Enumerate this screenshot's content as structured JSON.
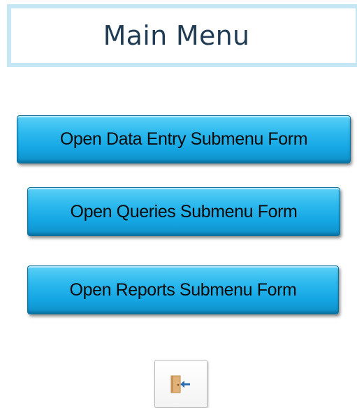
{
  "header": {
    "title": "Main Menu"
  },
  "menu": {
    "buttons": [
      {
        "label": "Open Data Entry Submenu Form"
      },
      {
        "label": "Open Queries Submenu Form"
      },
      {
        "label": "Open Reports Submenu Form"
      }
    ]
  },
  "exit_button": {
    "icon": "exit-door-icon"
  },
  "colors": {
    "title_border": "#c7e6f4",
    "title_text": "#1f3c54",
    "button_blue": "#14a6e3",
    "exit_icon_door": "#e0b27a",
    "exit_icon_arrow": "#2f6fb2"
  }
}
